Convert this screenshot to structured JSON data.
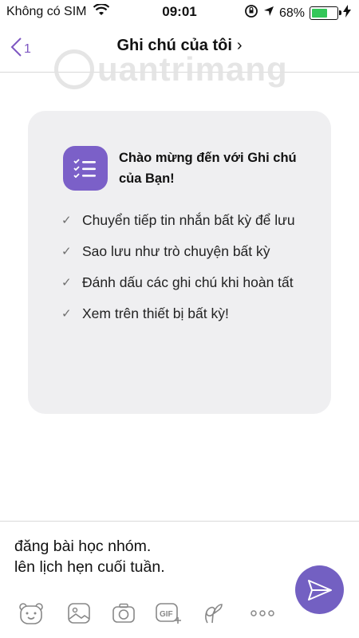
{
  "status_bar": {
    "carrier": "Không có SIM",
    "time": "09:01",
    "battery_percent": "68%",
    "battery_level": 0.68,
    "battery_color": "#34c759"
  },
  "nav": {
    "back_count": "1",
    "title": "Ghi chú của tôi",
    "title_chevron": "›"
  },
  "watermark": {
    "text": "uantrimang"
  },
  "welcome_card": {
    "icon": "checklist-icon",
    "title": "Chào mừng đến với Ghi chú của Bạn!",
    "features": [
      "Chuyển tiếp tin nhắn bất kỳ để lưu",
      "Sao lưu như trò chuyện bất kỳ",
      "Đánh dấu các ghi chú khi hoàn tất",
      "Xem trên thiết bị bất kỳ!"
    ]
  },
  "composer": {
    "line1": "đăng bài học nhóm.",
    "line2": "lên lịch hẹn cuối tuần.",
    "toolbar_icons": [
      "sticker-icon",
      "gallery-icon",
      "camera-icon",
      "gif-icon",
      "doodle-icon",
      "more-icon"
    ],
    "send_icon": "send-icon"
  },
  "colors": {
    "accent": "#7360c2",
    "card_bg": "#efeff1"
  }
}
